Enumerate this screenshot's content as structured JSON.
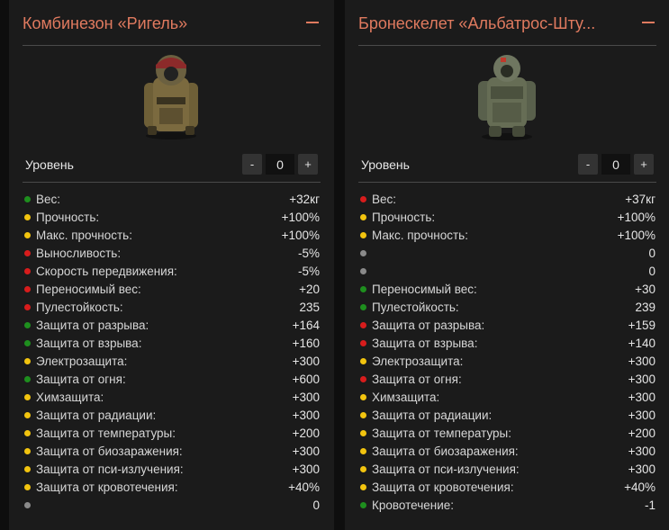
{
  "colors": {
    "green": "#1e8f1e",
    "yellow": "#f2c40f",
    "red": "#d81c1c",
    "gray": "#8a8a8a",
    "accent": "#e07a5f"
  },
  "cards": [
    {
      "title": "Комбинезон «Ригель»",
      "level_label": "Уровень",
      "level_value": "0",
      "minus_label": "-",
      "plus_label": "+",
      "stats": [
        {
          "dot": "green",
          "label": "Вес:",
          "value": "+32кг"
        },
        {
          "dot": "yellow",
          "label": "Прочность:",
          "value": "+100%"
        },
        {
          "dot": "yellow",
          "label": "Макс. прочность:",
          "value": "+100%"
        },
        {
          "dot": "red",
          "label": "Выносливость:",
          "value": "-5%"
        },
        {
          "dot": "red",
          "label": "Скорость передвижения:",
          "value": "-5%"
        },
        {
          "dot": "red",
          "label": "Переносимый вес:",
          "value": "+20"
        },
        {
          "dot": "red",
          "label": "Пулестойкость:",
          "value": "235"
        },
        {
          "dot": "green",
          "label": "Защита от разрыва:",
          "value": "+164"
        },
        {
          "dot": "green",
          "label": "Защита от взрыва:",
          "value": "+160"
        },
        {
          "dot": "yellow",
          "label": "Электрозащита:",
          "value": "+300"
        },
        {
          "dot": "green",
          "label": "Защита от огня:",
          "value": "+600"
        },
        {
          "dot": "yellow",
          "label": "Химзащита:",
          "value": "+300"
        },
        {
          "dot": "yellow",
          "label": "Защита от радиации:",
          "value": "+300"
        },
        {
          "dot": "yellow",
          "label": "Защита от температуры:",
          "value": "+200"
        },
        {
          "dot": "yellow",
          "label": "Защита от биозаражения:",
          "value": "+300"
        },
        {
          "dot": "yellow",
          "label": "Защита от пси-излучения:",
          "value": "+300"
        },
        {
          "dot": "yellow",
          "label": "Защита от кровотечения:",
          "value": "+40%"
        },
        {
          "dot": "gray",
          "label": "",
          "value": "0"
        }
      ]
    },
    {
      "title": "Бронескелет «Альбатрос-Шту...",
      "level_label": "Уровень",
      "level_value": "0",
      "minus_label": "-",
      "plus_label": "+",
      "stats": [
        {
          "dot": "red",
          "label": "Вес:",
          "value": "+37кг"
        },
        {
          "dot": "yellow",
          "label": "Прочность:",
          "value": "+100%"
        },
        {
          "dot": "yellow",
          "label": "Макс. прочность:",
          "value": "+100%"
        },
        {
          "dot": "gray",
          "label": "",
          "value": "0"
        },
        {
          "dot": "gray",
          "label": "",
          "value": "0"
        },
        {
          "dot": "green",
          "label": "Переносимый вес:",
          "value": "+30"
        },
        {
          "dot": "green",
          "label": "Пулестойкость:",
          "value": "239"
        },
        {
          "dot": "red",
          "label": "Защита от разрыва:",
          "value": "+159"
        },
        {
          "dot": "red",
          "label": "Защита от взрыва:",
          "value": "+140"
        },
        {
          "dot": "yellow",
          "label": "Электрозащита:",
          "value": "+300"
        },
        {
          "dot": "red",
          "label": "Защита от огня:",
          "value": "+300"
        },
        {
          "dot": "yellow",
          "label": "Химзащита:",
          "value": "+300"
        },
        {
          "dot": "yellow",
          "label": "Защита от радиации:",
          "value": "+300"
        },
        {
          "dot": "yellow",
          "label": "Защита от температуры:",
          "value": "+200"
        },
        {
          "dot": "yellow",
          "label": "Защита от биозаражения:",
          "value": "+300"
        },
        {
          "dot": "yellow",
          "label": "Защита от пси-излучения:",
          "value": "+300"
        },
        {
          "dot": "yellow",
          "label": "Защита от кровотечения:",
          "value": "+40%"
        },
        {
          "dot": "green",
          "label": "Кровотечение:",
          "value": "-1"
        }
      ]
    }
  ]
}
